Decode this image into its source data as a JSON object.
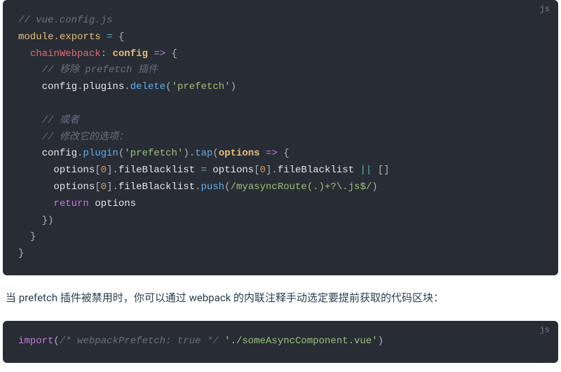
{
  "block1": {
    "lang": "js",
    "tokens": [
      [
        {
          "c": "comment",
          "t": "// vue.config.js"
        }
      ],
      [
        {
          "c": "keyword-module",
          "t": "module"
        },
        {
          "c": "punct",
          "t": "."
        },
        {
          "c": "builtin",
          "t": "exports"
        },
        {
          "c": "white",
          "t": " "
        },
        {
          "c": "operator",
          "t": "="
        },
        {
          "c": "white",
          "t": " "
        },
        {
          "c": "punct",
          "t": "{"
        }
      ],
      [
        {
          "c": "white",
          "t": "  "
        },
        {
          "c": "property",
          "t": "chainWebpack"
        },
        {
          "c": "punct",
          "t": ":"
        },
        {
          "c": "white",
          "t": " "
        },
        {
          "c": "param",
          "t": "config"
        },
        {
          "c": "white",
          "t": " "
        },
        {
          "c": "arrow",
          "t": "=>"
        },
        {
          "c": "white",
          "t": " "
        },
        {
          "c": "punct",
          "t": "{"
        }
      ],
      [
        {
          "c": "white",
          "t": "    "
        },
        {
          "c": "comment",
          "t": "// 移除 prefetch 插件"
        }
      ],
      [
        {
          "c": "white",
          "t": "    config"
        },
        {
          "c": "punct",
          "t": "."
        },
        {
          "c": "white",
          "t": "plugins"
        },
        {
          "c": "punct",
          "t": "."
        },
        {
          "c": "method",
          "t": "delete"
        },
        {
          "c": "punct",
          "t": "("
        },
        {
          "c": "string",
          "t": "'prefetch'"
        },
        {
          "c": "punct",
          "t": ")"
        }
      ],
      [
        {
          "c": "white",
          "t": ""
        }
      ],
      [
        {
          "c": "white",
          "t": "    "
        },
        {
          "c": "comment",
          "t": "// 或者"
        }
      ],
      [
        {
          "c": "white",
          "t": "    "
        },
        {
          "c": "comment",
          "t": "// 修改它的选项："
        }
      ],
      [
        {
          "c": "white",
          "t": "    config"
        },
        {
          "c": "punct",
          "t": "."
        },
        {
          "c": "method",
          "t": "plugin"
        },
        {
          "c": "punct",
          "t": "("
        },
        {
          "c": "string",
          "t": "'prefetch'"
        },
        {
          "c": "punct",
          "t": ")."
        },
        {
          "c": "method",
          "t": "tap"
        },
        {
          "c": "punct",
          "t": "("
        },
        {
          "c": "param",
          "t": "options"
        },
        {
          "c": "white",
          "t": " "
        },
        {
          "c": "arrow",
          "t": "=>"
        },
        {
          "c": "white",
          "t": " "
        },
        {
          "c": "punct",
          "t": "{"
        }
      ],
      [
        {
          "c": "white",
          "t": "      options"
        },
        {
          "c": "punct",
          "t": "["
        },
        {
          "c": "number",
          "t": "0"
        },
        {
          "c": "punct",
          "t": "]."
        },
        {
          "c": "white",
          "t": "fileBlacklist "
        },
        {
          "c": "operator",
          "t": "="
        },
        {
          "c": "white",
          "t": " options"
        },
        {
          "c": "punct",
          "t": "["
        },
        {
          "c": "number",
          "t": "0"
        },
        {
          "c": "punct",
          "t": "]."
        },
        {
          "c": "white",
          "t": "fileBlacklist "
        },
        {
          "c": "operator",
          "t": "||"
        },
        {
          "c": "white",
          "t": " "
        },
        {
          "c": "punct",
          "t": "[]"
        }
      ],
      [
        {
          "c": "white",
          "t": "      options"
        },
        {
          "c": "punct",
          "t": "["
        },
        {
          "c": "number",
          "t": "0"
        },
        {
          "c": "punct",
          "t": "]."
        },
        {
          "c": "white",
          "t": "fileBlacklist"
        },
        {
          "c": "punct",
          "t": "."
        },
        {
          "c": "method",
          "t": "push"
        },
        {
          "c": "punct",
          "t": "("
        },
        {
          "c": "regex",
          "t": "/myasyncRoute(.)+?\\.js$/"
        },
        {
          "c": "punct",
          "t": ")"
        }
      ],
      [
        {
          "c": "white",
          "t": "      "
        },
        {
          "c": "keyword",
          "t": "return"
        },
        {
          "c": "white",
          "t": " options"
        }
      ],
      [
        {
          "c": "white",
          "t": "    "
        },
        {
          "c": "punct",
          "t": "})"
        }
      ],
      [
        {
          "c": "white",
          "t": "  "
        },
        {
          "c": "punct",
          "t": "}"
        }
      ],
      [
        {
          "c": "punct",
          "t": "}"
        }
      ]
    ]
  },
  "prose": "当 prefetch 插件被禁用时，你可以通过 webpack 的内联注释手动选定要提前获取的代码区块：",
  "block2": {
    "lang": "js",
    "tokens": [
      [
        {
          "c": "keyword",
          "t": "import"
        },
        {
          "c": "punct",
          "t": "("
        },
        {
          "c": "comment",
          "t": "/* webpackPrefetch: true */"
        },
        {
          "c": "white",
          "t": " "
        },
        {
          "c": "string",
          "t": "'./someAsyncComponent.vue'"
        },
        {
          "c": "punct",
          "t": ")"
        }
      ]
    ]
  }
}
